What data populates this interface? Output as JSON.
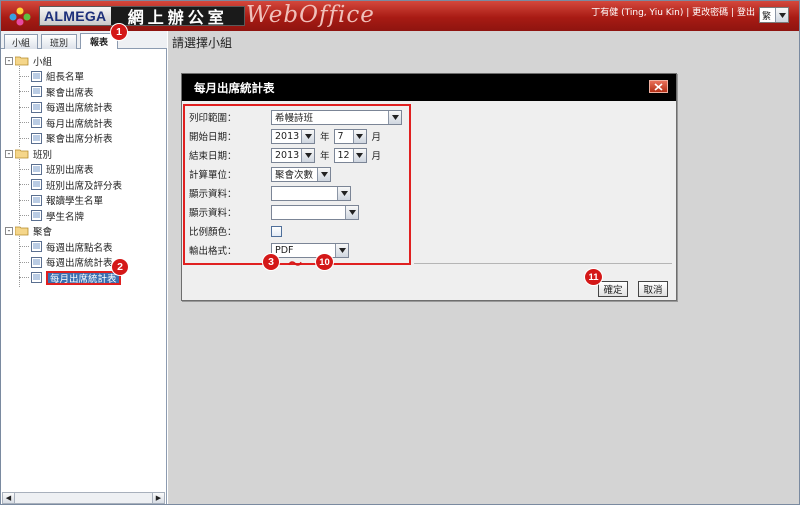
{
  "header": {
    "brand_name": "ALMEGA",
    "brand_cn": "網上辦公室",
    "app_title": "WebOffice",
    "user_name": "丁有健 (Ting, Yiu Kin)",
    "change_password": "更改密碼",
    "logout": "登出",
    "separator": "|",
    "language": "繁"
  },
  "left_tabs": [
    "小組",
    "班別",
    "報表"
  ],
  "tree": {
    "groups": [
      {
        "label": "小組",
        "toggle": "-",
        "items": [
          "組長名單",
          "聚會出席表",
          "每週出席統計表",
          "每月出席統計表",
          "聚會出席分析表"
        ]
      },
      {
        "label": "班別",
        "toggle": "-",
        "items": [
          "班別出席表",
          "班別出席及評分表",
          "報讀學生名單",
          "學生名牌"
        ]
      },
      {
        "label": "聚會",
        "toggle": "-",
        "items": [
          "每週出席點名表",
          "每週出席統計表",
          "每月出席統計表"
        ]
      }
    ]
  },
  "main": {
    "title": "請選擇小組"
  },
  "dialog": {
    "title": "每月出席統計表",
    "fields": {
      "print_range": {
        "label": "列印範圍：",
        "value": "希幔詩班"
      },
      "start_date": {
        "label": "開始日期：",
        "year": "2013",
        "year_unit": "年",
        "month": "7",
        "month_unit": "月"
      },
      "end_date": {
        "label": "結束日期：",
        "year": "2013",
        "year_unit": "年",
        "month": "12",
        "month_unit": "月"
      },
      "calc_unit": {
        "label": "計算單位：",
        "value": "聚會次數"
      },
      "display_1": {
        "label": "顯示資料：",
        "value": ""
      },
      "display_2": {
        "label": "顯示資料：",
        "value": ""
      },
      "ratio_color": {
        "label": "比例顏色："
      },
      "output_format": {
        "label": "輸出格式：",
        "value": "PDF"
      }
    },
    "ok_label": "確定",
    "cancel_label": "取消"
  },
  "annotations": {
    "badge1": "1",
    "badge2": "2",
    "badge3": "3",
    "tilde": "～",
    "badge10": "10",
    "badge11": "11"
  },
  "colors": {
    "header_red": "#a81b14",
    "highlight_red": "#e02020",
    "dialog_header": "#000000"
  }
}
